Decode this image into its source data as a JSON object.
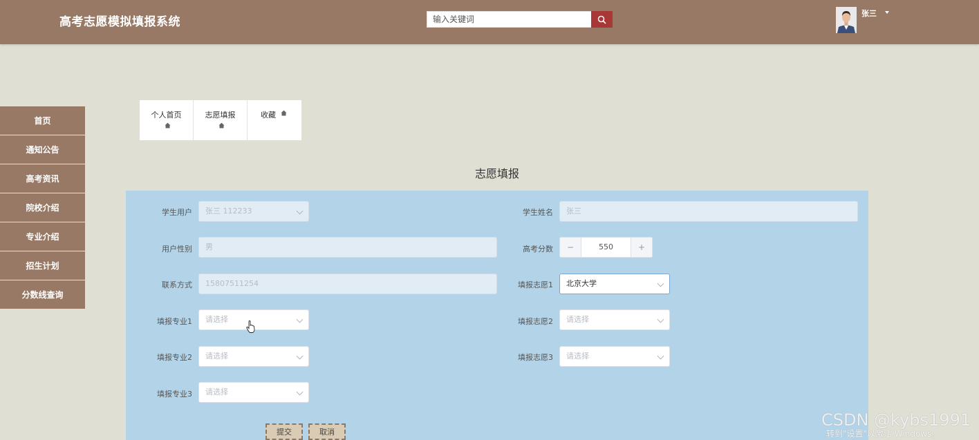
{
  "header": {
    "app_title": "高考志愿模拟填报系统",
    "search_placeholder": "输入关键词",
    "username": "张三"
  },
  "sidebar": {
    "items": [
      {
        "label": "首页"
      },
      {
        "label": "通知公告"
      },
      {
        "label": "高考资讯"
      },
      {
        "label": "院校介绍"
      },
      {
        "label": "专业介绍"
      },
      {
        "label": "招生计划"
      },
      {
        "label": "分数线查询"
      }
    ]
  },
  "tabs": [
    {
      "label": "个人首页"
    },
    {
      "label": "志愿填报"
    },
    {
      "label": "收藏"
    }
  ],
  "page_title": "志愿填报",
  "form": {
    "student_account": {
      "label": "学生用户",
      "value": "张三 112233"
    },
    "student_name": {
      "label": "学生姓名",
      "value": "张三"
    },
    "gender": {
      "label": "用户性别",
      "value": "男"
    },
    "score": {
      "label": "高考分数",
      "value": "550",
      "minus": "−",
      "plus": "+"
    },
    "phone": {
      "label": "联系方式",
      "value": "15807511254"
    },
    "choice1": {
      "label": "填报志愿1",
      "value": "北京大学"
    },
    "major1": {
      "label": "填报专业1",
      "placeholder": "请选择"
    },
    "choice2": {
      "label": "填报志愿2",
      "placeholder": "请选择"
    },
    "major2": {
      "label": "填报专业2",
      "placeholder": "请选择"
    },
    "choice3": {
      "label": "填报志愿3",
      "placeholder": "请选择"
    },
    "major3": {
      "label": "填报专业3",
      "placeholder": "请选择"
    },
    "submit_label": "提交",
    "cancel_label": "取消"
  },
  "overlay": {
    "watermark": "CSDN @kybs1991",
    "activation_text": "转到\"设置\"以激活 Windows。"
  },
  "colors": {
    "header_bg": "#977965",
    "page_bg": "#dfdfd3",
    "form_panel_bg": "#b3d4e8",
    "search_button": "#a83838"
  }
}
